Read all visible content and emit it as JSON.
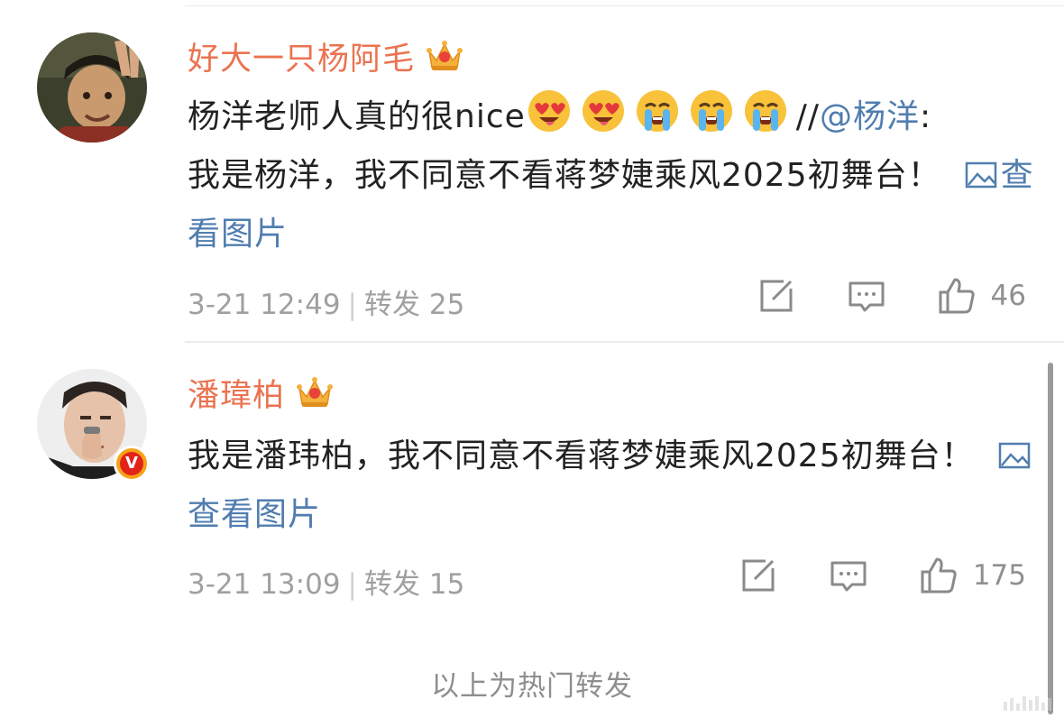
{
  "comments": [
    {
      "username": "好大一只杨阿毛",
      "body_part1": "杨洋老师人真的很nice",
      "repost_prefix": "//",
      "mention": "@杨洋",
      "body_part2": ":",
      "body_part3": "我是杨洋，我不同意不看蒋梦婕乘风2025初舞台！",
      "view_pic": "查看图片",
      "time": "3-21 12:49",
      "repost_label": "转发 25",
      "likes": "46"
    },
    {
      "username": "潘瑋柏",
      "verified_badge": "V",
      "body_text": "我是潘玮柏，我不同意不看蒋梦婕乘风2025初舞台！",
      "view_pic": "查看图片",
      "time": "3-21 13:09",
      "repost_label": "转发 15",
      "likes": "175"
    }
  ],
  "meta_separator": "|",
  "footer": "以上为热门转发",
  "colors": {
    "username": "#eb7350",
    "link": "#507daf",
    "meta": "#a0a0a0",
    "text": "#222222"
  },
  "icons": [
    "crown-icon",
    "heart-eyes-emoji",
    "crying-emoji",
    "image-icon",
    "edit-icon",
    "comment-icon",
    "thumbs-up-icon"
  ]
}
